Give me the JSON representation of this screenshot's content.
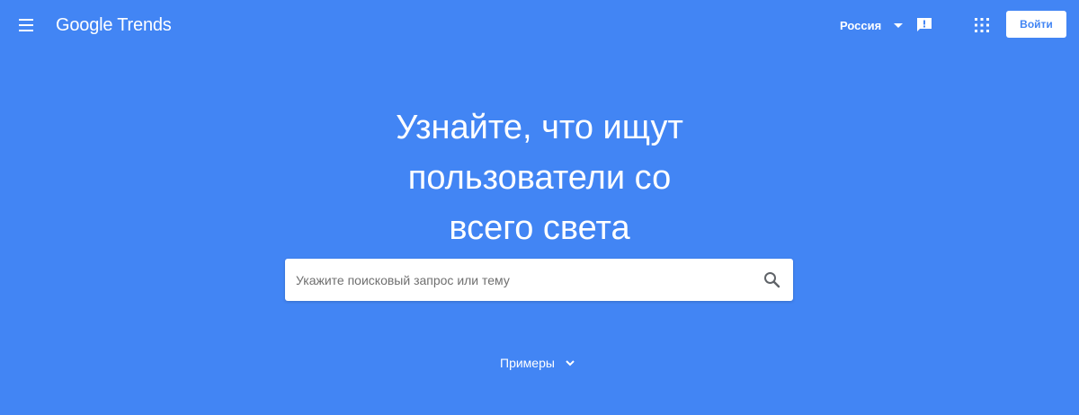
{
  "header": {
    "logo": "Google Trends",
    "region": "Россия",
    "signin_label": "Войти",
    "icons": [
      "menu-icon",
      "feedback-icon",
      "apps-grid-icon",
      "chevron-down-icon"
    ]
  },
  "hero": {
    "line1": "Узнайте, что ищут",
    "line2": "пользователи со",
    "line3": "всего света"
  },
  "search": {
    "placeholder": "Укажите поисковый запрос или тему",
    "value": "",
    "icon": "search-icon"
  },
  "examples": {
    "label": "Примеры",
    "icon": "chevron-down-icon"
  },
  "colors": {
    "background": "#4285f4",
    "text": "#ffffff",
    "button_text": "#4285f4"
  }
}
